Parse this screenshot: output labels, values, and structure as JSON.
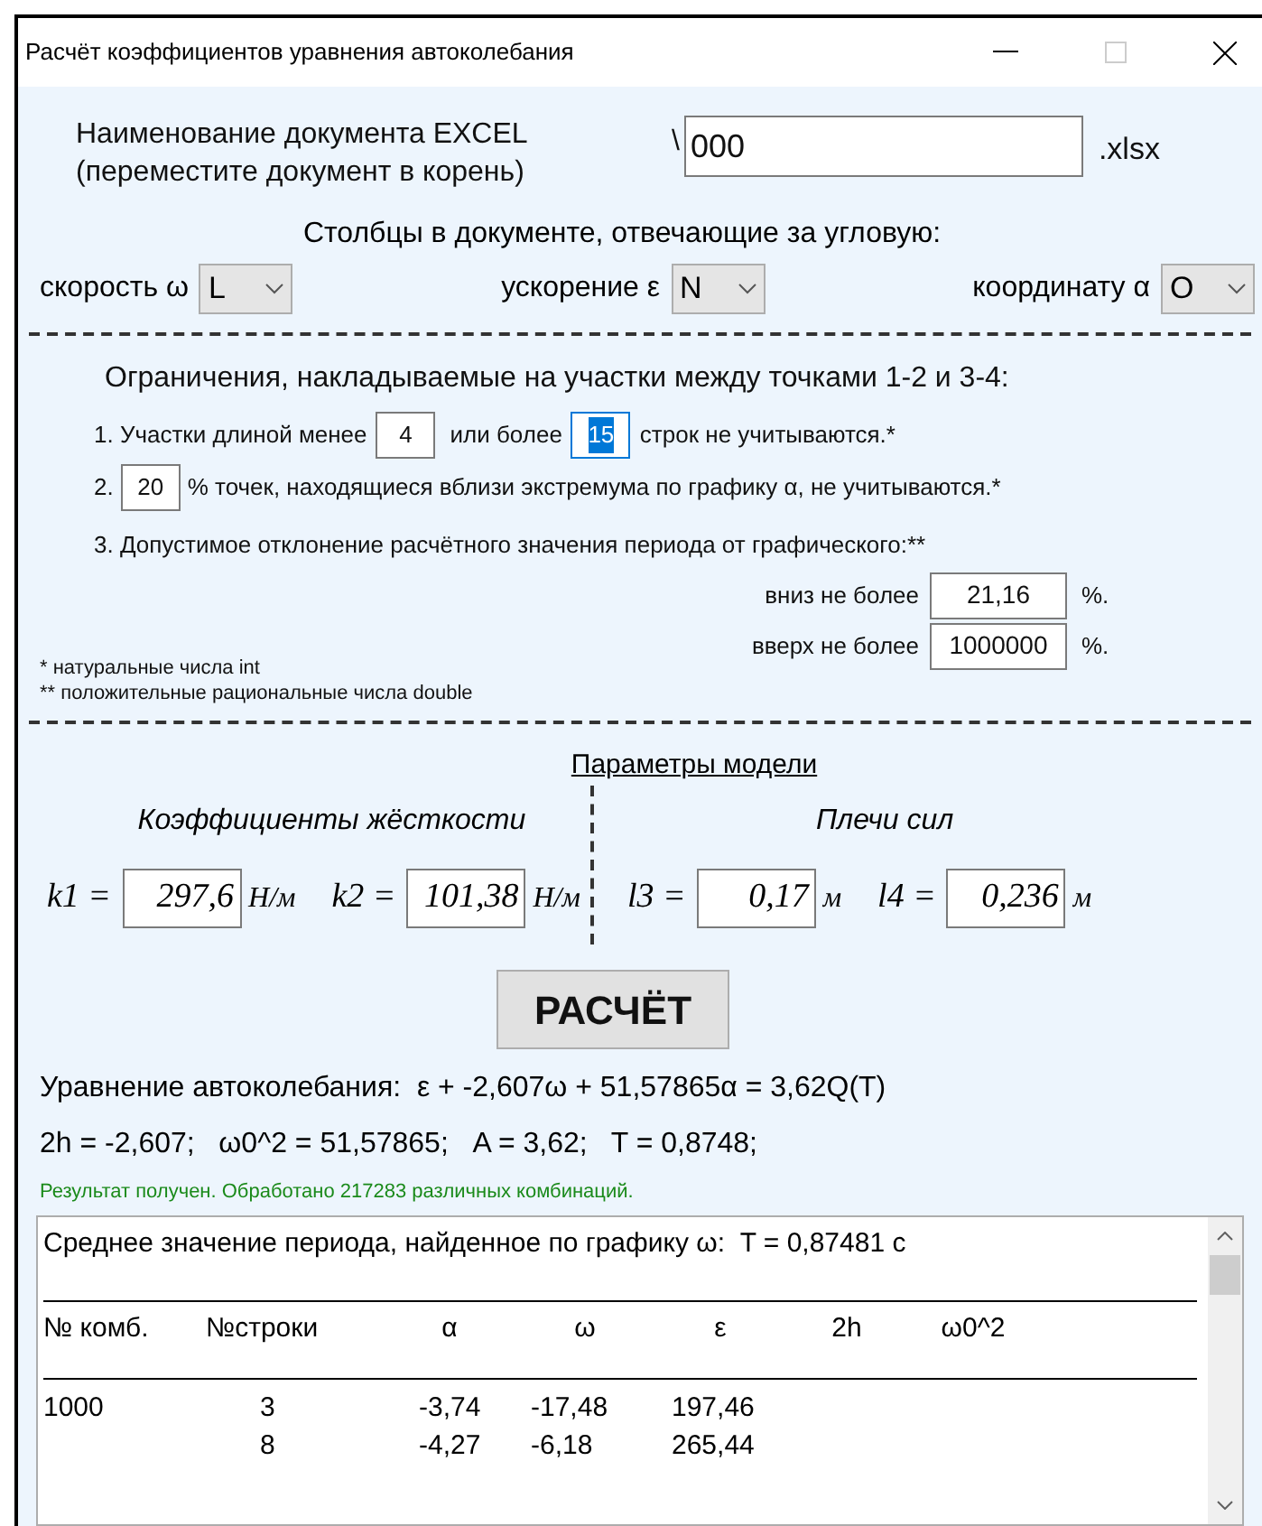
{
  "window": {
    "title": "Расчёт коэффициентов уравнения автоколебания"
  },
  "file": {
    "label_line1": "Наименование документа EXCEL",
    "label_line2": "(переместите документ в корень)",
    "prefix": "\\",
    "value": "000",
    "suffix": ".xlsx"
  },
  "columns": {
    "heading": "Столбцы в документе, отвечающие за угловую:",
    "selects": [
      {
        "label": "скорость ω",
        "value": "L"
      },
      {
        "label": "ускорение ε",
        "value": "N"
      },
      {
        "label": "координату α",
        "value": "O"
      }
    ]
  },
  "limits": {
    "heading": "Ограничения, накладываемые на участки между точками 1-2 и 3-4:",
    "rule1": {
      "before": "1. Участки длиной менее",
      "min": "4",
      "middle": "или более",
      "max": "15",
      "max_text_selected": true,
      "after": "строк не учитываются.*"
    },
    "rule2": {
      "before": "2.",
      "value": "20",
      "after": "% точек, находящиеся вблизи экстремума по графику α, не учитываются.*"
    },
    "rule3": {
      "text": "3. Допустимое отклонение расчётного значения периода от графического:**",
      "down_label": "вниз не более",
      "down_value": "21,16",
      "down_unit": "%.",
      "up_label": "вверх не более",
      "up_value": "1000000",
      "up_unit": "%."
    },
    "notes": [
      "* натуральные числа int",
      "** положительные рациональные числа double"
    ]
  },
  "model": {
    "heading": "Параметры модели",
    "groups": [
      {
        "title": "Коэффициенты жёсткости",
        "params": [
          {
            "name": "k1 =",
            "value": "297,6",
            "unit": "Н/м"
          },
          {
            "name": "k2 =",
            "value": "101,38",
            "unit": "Н/м"
          }
        ]
      },
      {
        "title": "Плечи сил",
        "params": [
          {
            "name": "l3 =",
            "value": "0,17",
            "unit": "м"
          },
          {
            "name": "l4 =",
            "value": "0,236",
            "unit": "м"
          }
        ]
      }
    ]
  },
  "calculate_button": "РАСЧЁТ",
  "result": {
    "equation": "Уравнение автоколебания:  ε + -2,607ω + 51,57865α = 3,62Q(T)",
    "summary": "2h = -2,607;   ω0^2 = 51,57865;   A = 3,62;   T = 0,8748;",
    "status": "Результат получен. Обработано 217283 различных комбинаций."
  },
  "output": {
    "period_line": "Среднее значение периода, найденное по графику ω:  T = 0,87481 c",
    "columns": [
      "№ комб.",
      "№строки",
      "α",
      "ω",
      "ε",
      "2h",
      "ω0^2"
    ],
    "rows": [
      {
        "cells": [
          "1000",
          "3",
          "-3,74",
          "-17,48",
          "197,46"
        ]
      },
      {
        "cells": [
          null,
          "8",
          "-4,27",
          "-6,18",
          "265,44"
        ]
      }
    ]
  }
}
